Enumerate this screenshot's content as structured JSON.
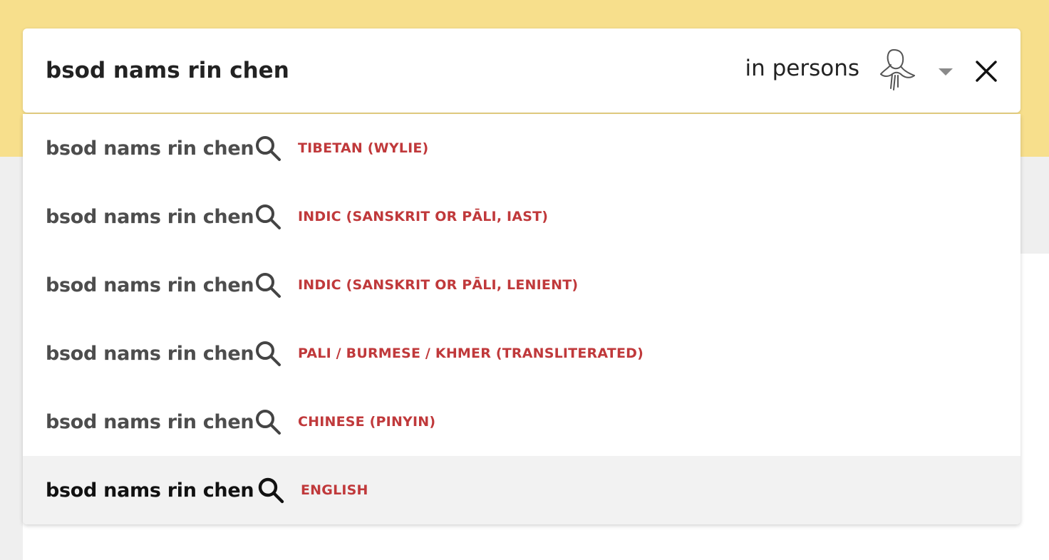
{
  "search": {
    "query": "bsod nams rin chen",
    "scope_label": "in persons",
    "scope_icon": "person-icon",
    "caret_icon": "caret-down-icon",
    "close_icon": "close-icon"
  },
  "colors": {
    "header_yellow": "#f7df8c",
    "language_red": "#c0393b",
    "active_row": "#f2f2f2"
  },
  "suggestions": [
    {
      "text": "bsod nams rin chen",
      "icon": "search-icon",
      "language": "TIBETAN (WYLIE)"
    },
    {
      "text": "bsod nams rin chen",
      "icon": "search-icon",
      "language": "INDIC (SANSKRIT OR PĀLI, IAST)"
    },
    {
      "text": "bsod nams rin chen",
      "icon": "search-icon",
      "language": "INDIC (SANSKRIT OR PĀLI, LENIENT)"
    },
    {
      "text": "bsod nams rin chen",
      "icon": "search-icon",
      "language": "PALI / BURMESE / KHMER (TRANSLITERATED)"
    },
    {
      "text": "bsod nams rin chen",
      "icon": "search-icon",
      "language": "CHINESE (PINYIN)"
    },
    {
      "text": "bsod nams rin chen",
      "icon": "search-icon",
      "language": "ENGLISH",
      "active": true
    }
  ]
}
